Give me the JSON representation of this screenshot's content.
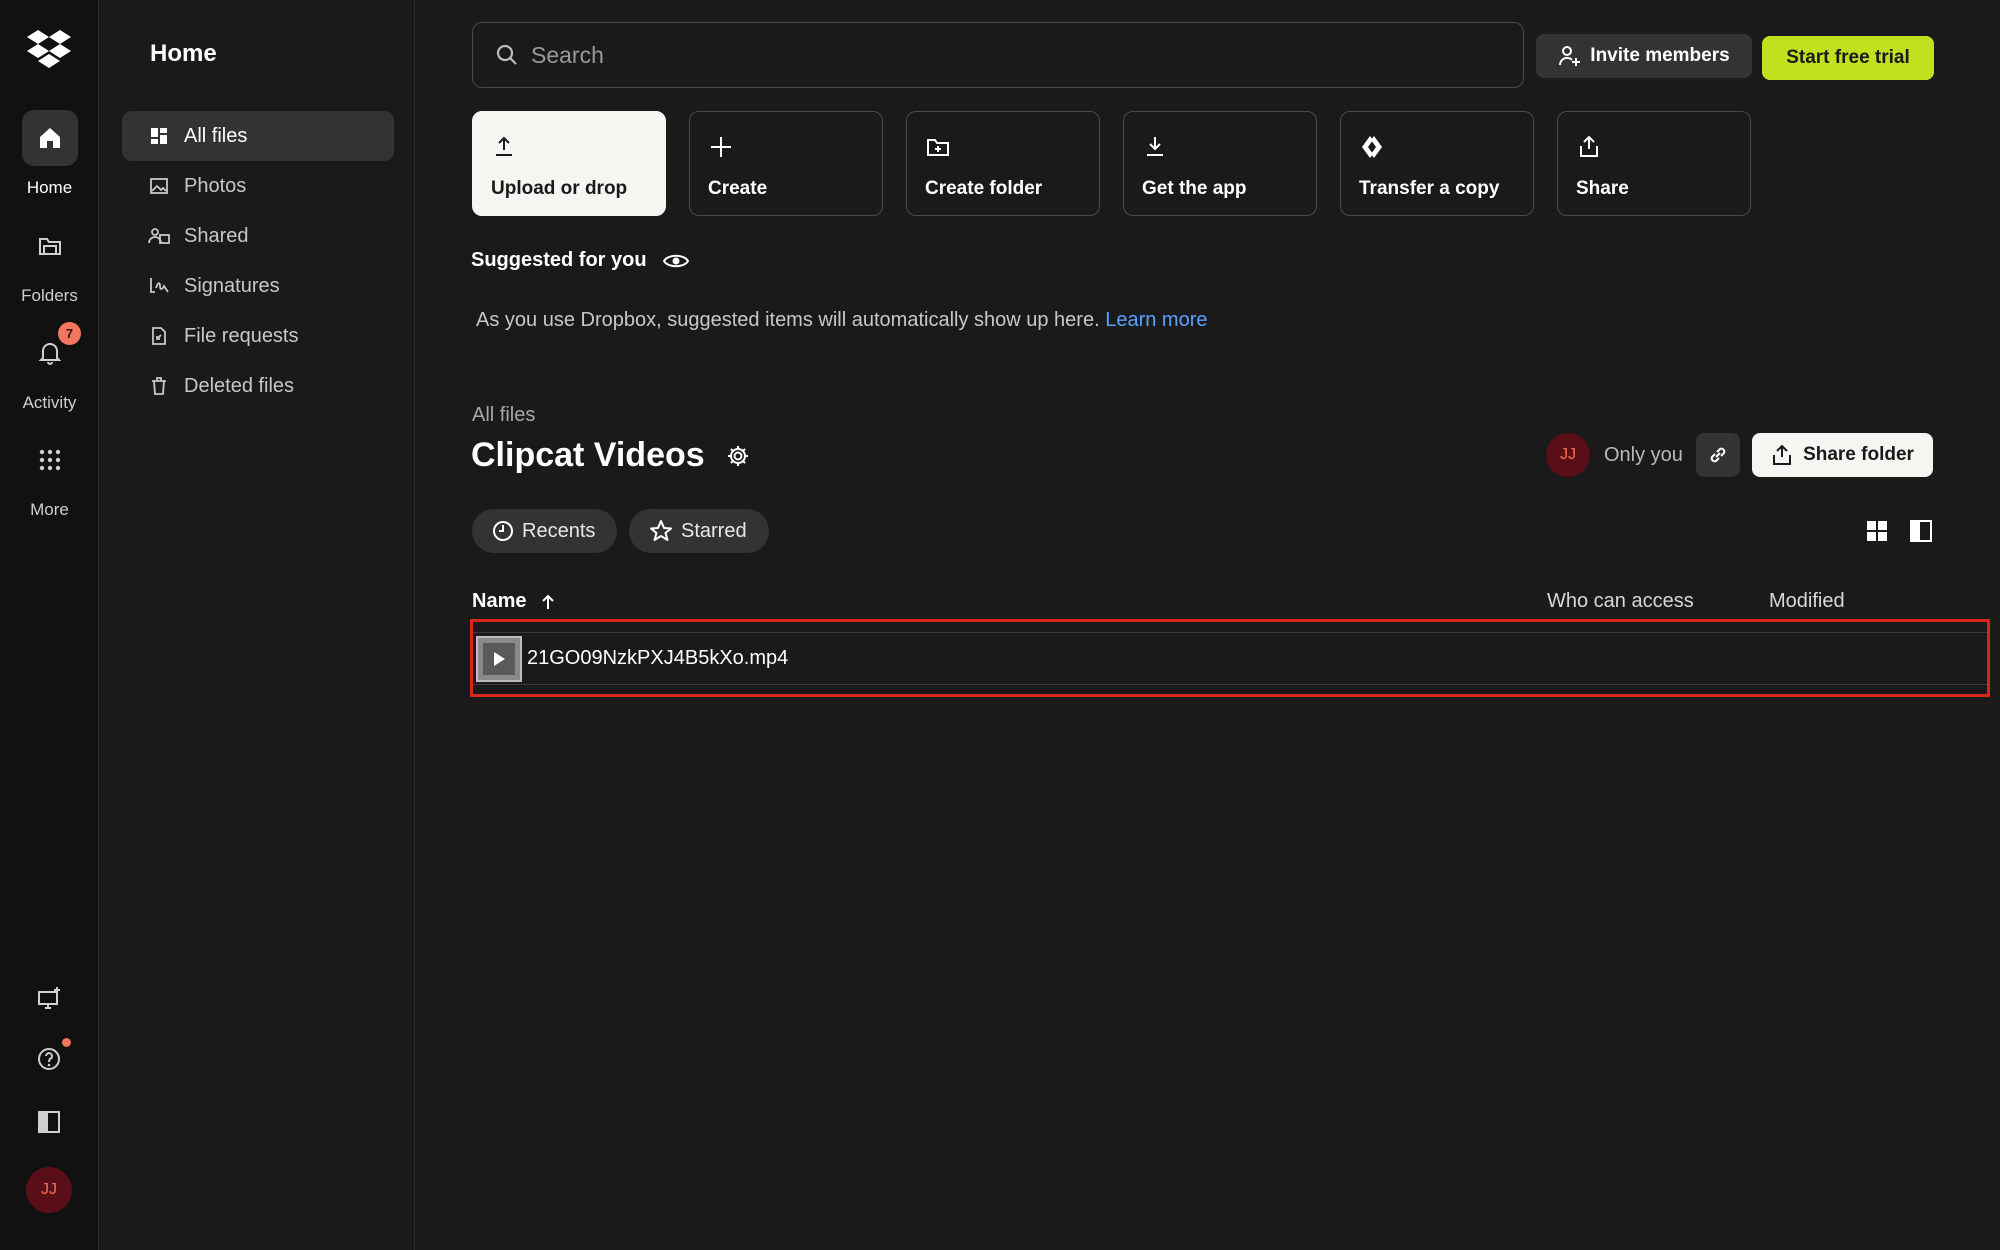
{
  "rail": {
    "home": "Home",
    "folders": "Folders",
    "activity": "Activity",
    "activity_badge": "7",
    "more": "More",
    "avatar_initials": "JJ"
  },
  "sidebar": {
    "title": "Home",
    "items": [
      {
        "label": "All files",
        "icon": "all-files-icon"
      },
      {
        "label": "Photos",
        "icon": "photos-icon"
      },
      {
        "label": "Shared",
        "icon": "shared-icon"
      },
      {
        "label": "Signatures",
        "icon": "signatures-icon"
      },
      {
        "label": "File requests",
        "icon": "file-requests-icon"
      },
      {
        "label": "Deleted files",
        "icon": "trash-icon"
      }
    ]
  },
  "header": {
    "search_placeholder": "Search",
    "invite_label": "Invite members",
    "trial_label": "Start free trial"
  },
  "actions": [
    {
      "label": "Upload or drop",
      "icon": "upload-icon"
    },
    {
      "label": "Create",
      "icon": "plus-icon"
    },
    {
      "label": "Create folder",
      "icon": "folder-plus-icon"
    },
    {
      "label": "Get the app",
      "icon": "download-icon"
    },
    {
      "label": "Transfer a copy",
      "icon": "transfer-icon"
    },
    {
      "label": "Share",
      "icon": "share-icon"
    }
  ],
  "suggested": {
    "title": "Suggested for you",
    "text": "As you use Dropbox, suggested items will automatically show up here.",
    "link": "Learn more"
  },
  "folder": {
    "breadcrumb": "All files",
    "title": "Clipcat Videos",
    "owner_initials": "JJ",
    "access_label": "Only you",
    "share_label": "Share folder"
  },
  "filters": {
    "recents": "Recents",
    "starred": "Starred"
  },
  "table": {
    "columns": [
      "Name",
      "Who can access",
      "Modified"
    ],
    "rows": [
      {
        "name": "21GO09NzkPXJ4B5kXo.mp4",
        "who_can_access": "",
        "modified": ""
      }
    ]
  },
  "colors": {
    "accent_green": "#c3e01f",
    "link_blue": "#5aa2ff",
    "badge_orange": "#f3765d",
    "highlight_red": "#d9261c",
    "avatar_bg": "#5a0e17"
  }
}
